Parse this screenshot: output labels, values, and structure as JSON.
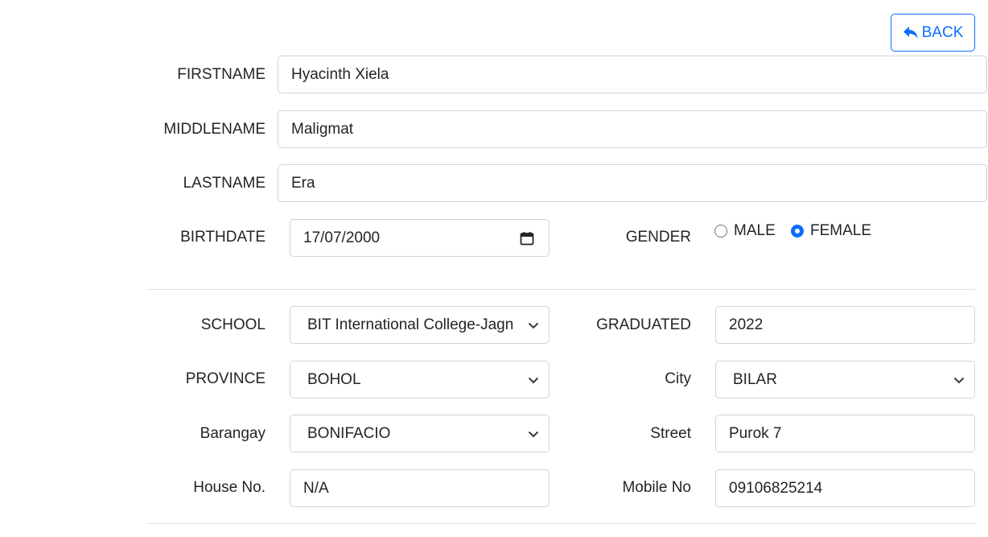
{
  "back_button": {
    "label": "BACK"
  },
  "personal": {
    "firstname": {
      "label": "FIRSTNAME",
      "value": "Hyacinth Xiela"
    },
    "middlename": {
      "label": "MIDDLENAME",
      "value": "Maligmat"
    },
    "lastname": {
      "label": "LASTNAME",
      "value": "Era"
    },
    "birthdate": {
      "label": "BIRTHDATE",
      "value": "17/07/2000"
    },
    "gender": {
      "label": "GENDER",
      "options": [
        {
          "label": "MALE",
          "checked": false
        },
        {
          "label": "FEMALE",
          "checked": true
        }
      ]
    }
  },
  "education_address": {
    "school": {
      "label": "SCHOOL",
      "value": "BIT International College-Jagn"
    },
    "graduated": {
      "label": "GRADUATED",
      "value": "2022"
    },
    "province": {
      "label": "PROVINCE",
      "value": "BOHOL"
    },
    "city": {
      "label": "City",
      "value": "BILAR"
    },
    "barangay": {
      "label": "Barangay",
      "value": "BONIFACIO"
    },
    "street": {
      "label": "Street",
      "value": "Purok 7"
    },
    "house_no": {
      "label": "House No.",
      "value": "N/A"
    },
    "mobile_no": {
      "label": "Mobile No",
      "value": "09106825214"
    }
  },
  "colors": {
    "primary": "#0d6efd",
    "border": "#ced4da",
    "text": "#212529"
  }
}
